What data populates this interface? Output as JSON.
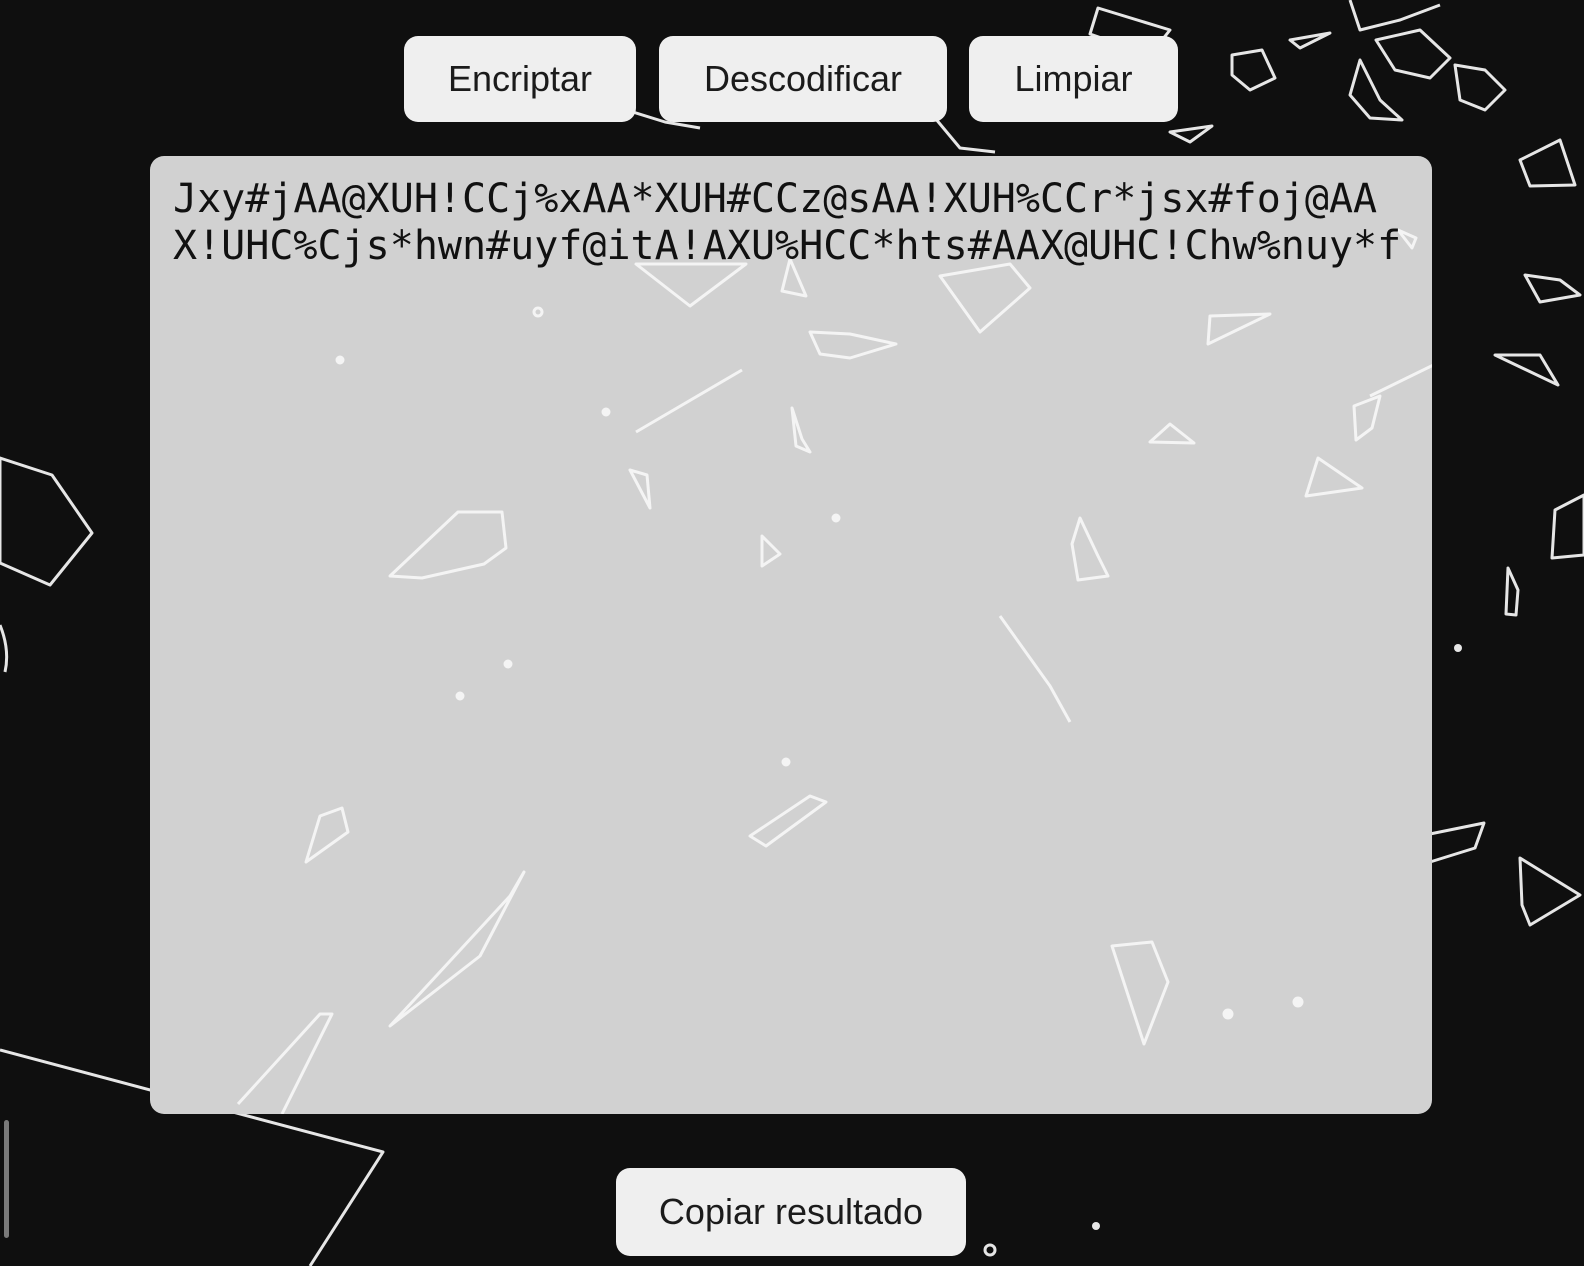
{
  "toolbar": {
    "encrypt_label": "Encriptar",
    "decode_label": "Descodificar",
    "clear_label": "Limpiar"
  },
  "result": {
    "text": "Jxy#jAA@XUH!CCj%xAA*XUH#CCz@sAA!XUH%CCr*jsx#foj@AAX!UHC%Cjs*hwn#uyf@itA!AXU%HCC*hts#AAX@UHC!Chw%nuy*f"
  },
  "footer": {
    "copy_label": "Copiar resultado"
  },
  "colors": {
    "background": "#0f0f0f",
    "panel": "#d1d1d1",
    "button": "#efefef",
    "shard_stroke": "#ffffff"
  }
}
